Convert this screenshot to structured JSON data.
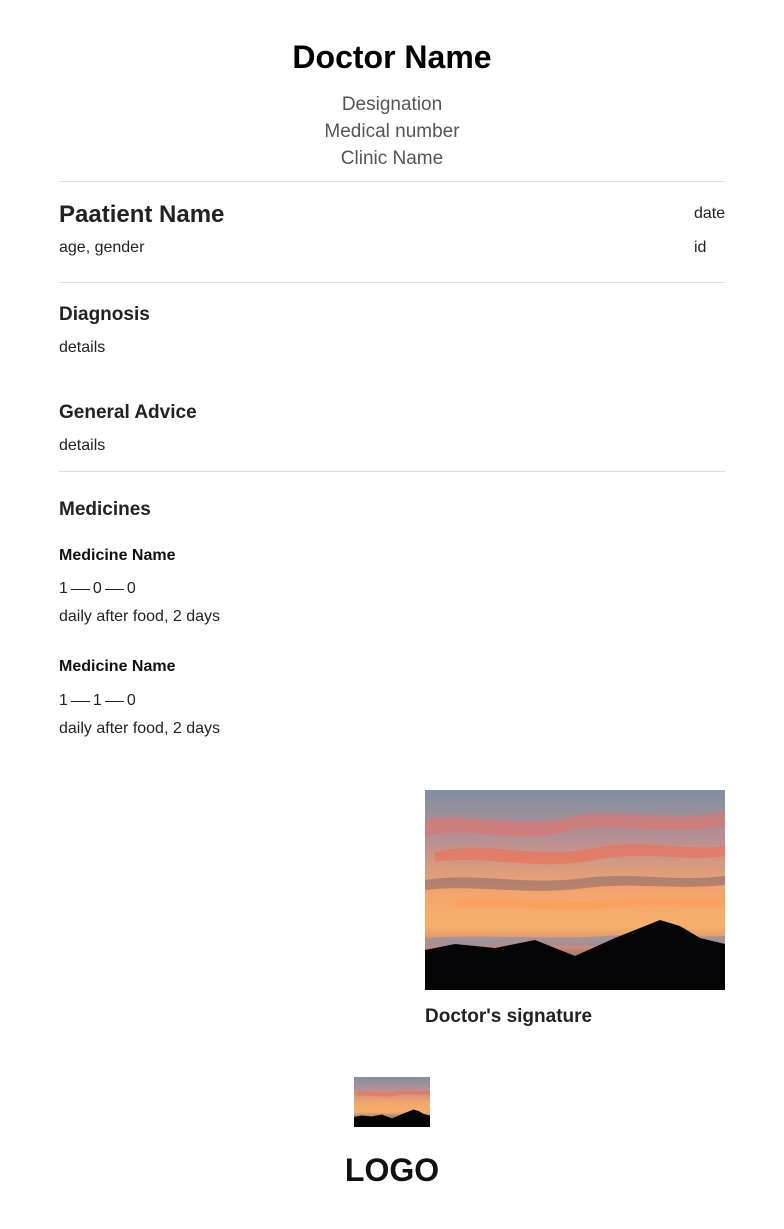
{
  "doctor": {
    "name": "Doctor Name",
    "designation": "Designation",
    "medical_number": "Medical number",
    "clinic_name": "Clinic Name"
  },
  "patient": {
    "name": "Paatient Name",
    "meta": "age, gender",
    "date": "date",
    "id": "id"
  },
  "diagnosis": {
    "title": "Diagnosis",
    "details": "details"
  },
  "advice": {
    "title": "General Advice",
    "details": "details"
  },
  "medicines": {
    "title": "Medicines",
    "items": [
      {
        "name": "Medicine Name",
        "dose": [
          "1",
          "0",
          "0"
        ],
        "instructions": "daily after food, 2 days"
      },
      {
        "name": "Medicine Name",
        "dose": [
          "1",
          "1",
          "0"
        ],
        "instructions": "daily after food, 2 days"
      }
    ]
  },
  "signature": {
    "label": "Doctor's signature",
    "image": "sunset-mountain-photo"
  },
  "logo": {
    "text": "LOGO",
    "image": "sunset-mountain-photo"
  },
  "colors": {
    "text": "#222222",
    "muted": "#555555",
    "divider": "#dddddd"
  }
}
